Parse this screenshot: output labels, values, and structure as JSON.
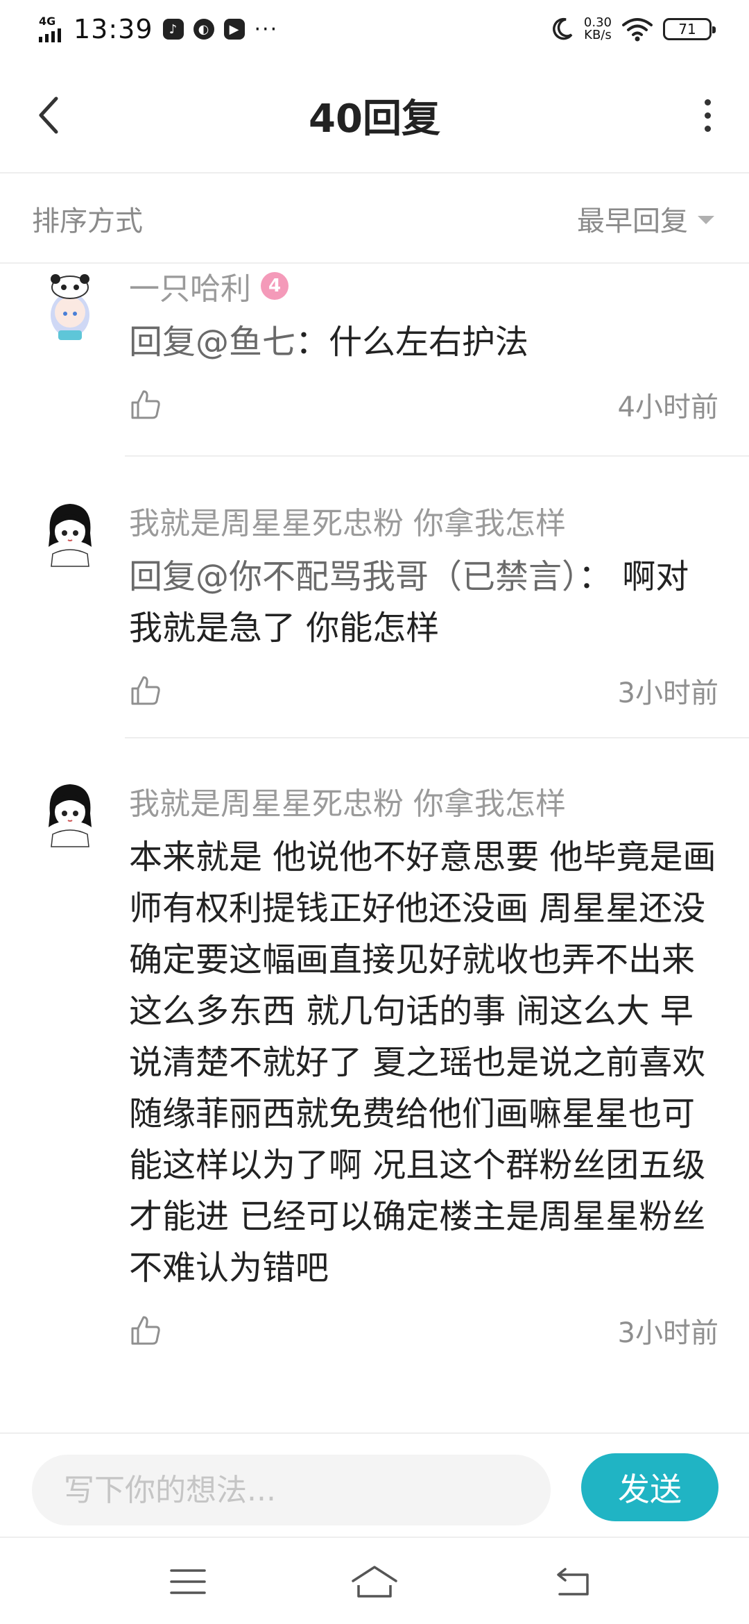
{
  "status_bar": {
    "network": "4G",
    "time": "13:39",
    "more": "···",
    "speed_value": "0.30",
    "speed_unit": "KB/s",
    "battery": "71"
  },
  "header": {
    "title": "40回复"
  },
  "sort": {
    "label": "排序方式",
    "selected": "最早回复"
  },
  "comments": [
    {
      "username": "一只哈利",
      "level": "4",
      "mention_prefix": "回复@",
      "mention_name": "鱼七",
      "text": "：什么左右护法",
      "time": "4小时前"
    },
    {
      "username": "我就是周星星死忠粉 你拿我怎样",
      "mention_prefix": "回复@",
      "mention_name": "你不配骂我哥（已禁言）",
      "text": "：  啊对 我就是急了 你能怎样",
      "time": "3小时前"
    },
    {
      "username": "我就是周星星死忠粉 你拿我怎样",
      "text": "本来就是 他说他不好意思要 他毕竟是画师有权利提钱正好他还没画 周星星还没确定要这幅画直接见好就收也弄不出来这么多东西 就几句话的事 闹这么大 早说清楚不就好了  夏之瑶也是说之前喜欢随缘菲丽西就免费给他们画嘛星星也可能这样以为了啊 况且这个群粉丝团五级才能进 已经可以确定楼主是周星星粉丝 不难认为错吧",
      "time": "3小时前"
    }
  ],
  "composer": {
    "placeholder": "写下你的想法...",
    "send_label": "发送"
  },
  "colors": {
    "accent": "#20b4c4",
    "level_badge": "#f49ab9",
    "muted_text": "#9a9a9a"
  },
  "icons": {
    "back": "chevron-left-icon",
    "menu": "more-vertical-icon",
    "like": "thumbs-up-icon",
    "nav_menu": "hamburger-icon",
    "nav_home": "home-icon",
    "nav_back": "return-icon"
  }
}
